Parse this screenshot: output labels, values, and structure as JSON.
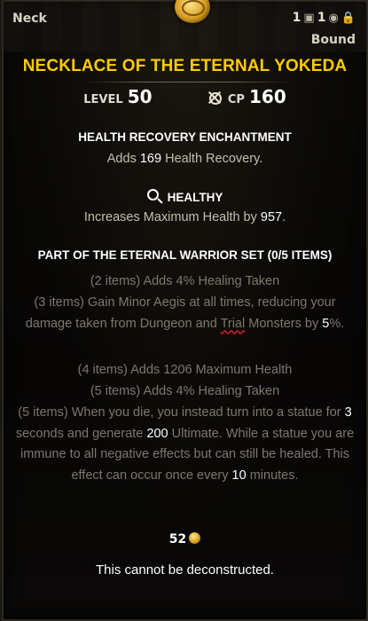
{
  "header": {
    "slot": "Neck",
    "count_a": "1",
    "count_b": "1",
    "bound": "Bound"
  },
  "item": {
    "name": "NECKLACE OF THE ETERNAL YOKEDA",
    "level_label": "LEVEL",
    "level": "50",
    "cp_label": "CP",
    "cp": "160",
    "name_color": "#ffcc00"
  },
  "enchantment": {
    "title": "HEALTH RECOVERY ENCHANTMENT",
    "pre": "Adds ",
    "amount": "169",
    "post": " Health Recovery."
  },
  "trait": {
    "title": "HEALTHY",
    "pre": "Increases Maximum Health by ",
    "amount": "957",
    "post": "."
  },
  "set": {
    "title": "PART OF THE ETERNAL WARRIOR SET (0/5 ITEMS)",
    "bonus1": "(2 items) Adds 4% Healing Taken",
    "bonus2_a": "(3 items) Gain Minor Aegis at all times, reducing your damage taken from Dungeon and ",
    "bonus2_trial": "Trial",
    "bonus2_b": " Monsters by ",
    "bonus2_pct": "5",
    "bonus2_c": "%.",
    "bonus3": "(4 items) Adds 1206 Maximum Health",
    "bonus4": "(5 items) Adds 4% Healing Taken",
    "bonus5_a": "(5 items) When you die, you instead turn into a statue for ",
    "bonus5_secs": "3",
    "bonus5_b": " seconds and generate ",
    "bonus5_ult": "200",
    "bonus5_c": " Ultimate. While a statue you are immune to all negative effects but can still be healed. This effect can occur once every ",
    "bonus5_mins": "10",
    "bonus5_d": " minutes."
  },
  "footer": {
    "value": "52",
    "note": "This cannot be deconstructed."
  },
  "icons": {
    "ornament": "gold-medallion-icon",
    "bank": "bank-chest-icon",
    "bag": "inventory-bag-icon",
    "cp": "champion-point-icon",
    "trait": "magnifier-icon",
    "currency": "gold-coin-icon"
  }
}
